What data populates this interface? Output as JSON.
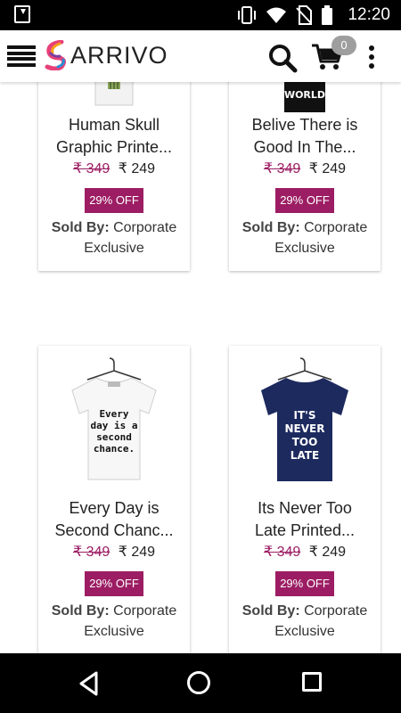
{
  "status_bar": {
    "time": "12:20"
  },
  "app_bar": {
    "logo_text": "ARRIVO",
    "cart_count": "0"
  },
  "colors": {
    "accent": "#9c1d63",
    "navy_shirt": "#1d2a5e"
  },
  "products": [
    {
      "title_line1": "Human Skull",
      "title_line2": "Graphic Printe...",
      "old_price": "₹ 349",
      "new_price": "₹ 249",
      "discount": "29% OFF",
      "sold_label": "Sold By:",
      "seller_line1": "Corporate",
      "seller_line2": "Exclusive",
      "shirt_print": ""
    },
    {
      "title_line1": "Belive There is",
      "title_line2": "Good In The...",
      "old_price": "₹ 349",
      "new_price": "₹ 249",
      "discount": "29% OFF",
      "sold_label": "Sold By:",
      "seller_line1": "Corporate",
      "seller_line2": "Exclusive",
      "shirt_print": "WORLD"
    },
    {
      "title_line1": "Every Day is",
      "title_line2": "Second Chanc...",
      "old_price": "₹ 349",
      "new_price": "₹ 249",
      "discount": "29% OFF",
      "sold_label": "Sold By:",
      "seller_line1": "Corporate",
      "seller_line2": "Exclusive",
      "shirt_print": [
        "Every",
        "day is a",
        "second",
        "chance."
      ]
    },
    {
      "title_line1": "Its Never Too",
      "title_line2": "Late Printed...",
      "old_price": "₹ 349",
      "new_price": "₹ 249",
      "discount": "29% OFF",
      "sold_label": "Sold By:",
      "seller_line1": "Corporate",
      "seller_line2": "Exclusive",
      "shirt_print": [
        "IT'S",
        "NEVER",
        "TOO",
        "LATE"
      ]
    }
  ]
}
